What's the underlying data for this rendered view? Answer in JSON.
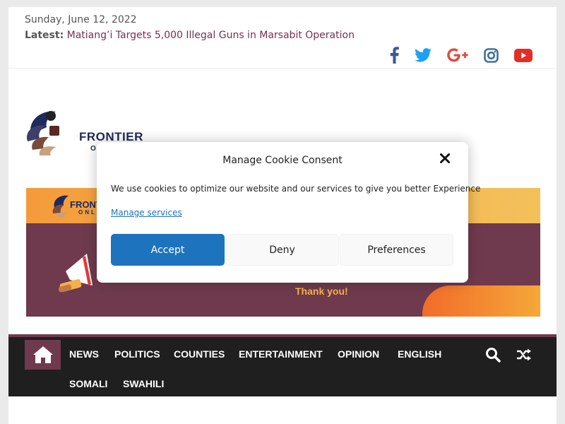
{
  "topbar": {
    "date": "Sunday, June 12, 2022",
    "latest_label": "Latest:",
    "latest_headline": "Matiang’i Targets 5,000 Illegal Guns in Marsabit Operation"
  },
  "social": {
    "icons": [
      "facebook-icon",
      "twitter-icon",
      "google-plus-icon",
      "instagram-icon",
      "youtube-icon"
    ],
    "colors": {
      "facebook": "#3b5998",
      "twitter": "#1da1f2",
      "google_plus": "#dc4e41",
      "instagram": "#3f729b",
      "youtube": "#e52d27"
    }
  },
  "logo": {
    "text": "FRONTIER",
    "sub": "ONL"
  },
  "banner": {
    "logo_text": "FRONTIER",
    "logo_sub": "ONLI",
    "thanks": "Thank you!"
  },
  "nav": {
    "items": [
      "NEWS",
      "POLITICS",
      "COUNTIES",
      "ENTERTAINMENT",
      "OPINION",
      "ENGLISH",
      "SOMALI",
      "SWAHILI"
    ],
    "accent": "#6f3a4d"
  },
  "cookie": {
    "title": "Manage Cookie Consent",
    "message": "We use cookies to optimize our website and our services to give you better Experience",
    "manage_link": "Manage services",
    "accept": "Accept",
    "deny": "Deny",
    "preferences": "Preferences",
    "accent": "#1e73be"
  }
}
